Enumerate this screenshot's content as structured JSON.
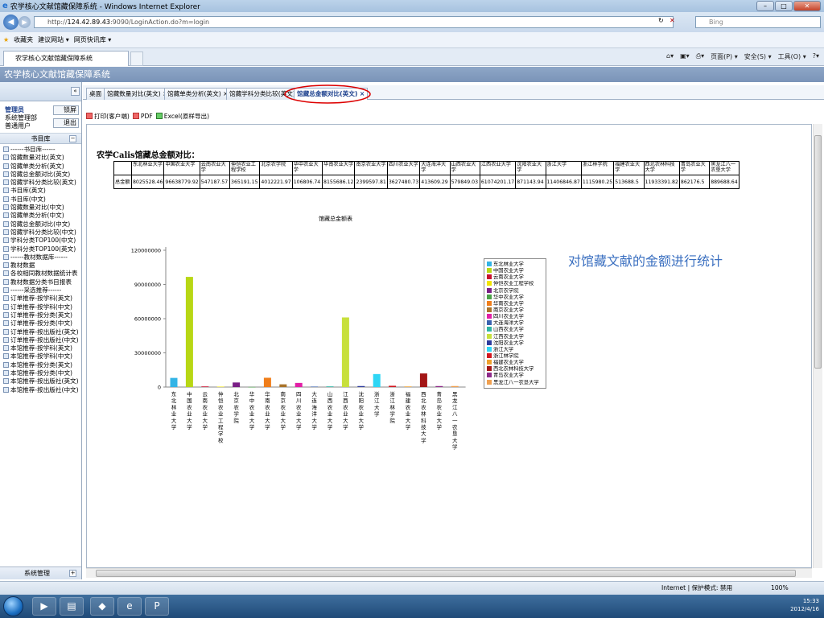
{
  "window": {
    "title": "农学核心文献馆藏保障系统 - Windows Internet Explorer",
    "min": "–",
    "max": "□",
    "close": "✕"
  },
  "address": {
    "prefix": "http://",
    "host": "124.42.89.43",
    "rest": ":9090/LoginAction.do?m=login",
    "search_placeholder": "Bing"
  },
  "favorites": {
    "label": "收藏夹",
    "items": [
      "建议网站 ▾",
      "网页快讯库 ▾"
    ]
  },
  "browser_tab": {
    "label": "农学核心文献馆藏保障系统"
  },
  "command_bar": [
    "页面(P) ▾",
    "安全(S) ▾",
    "工具(O) ▾"
  ],
  "app": {
    "header": "农学核心文献馆藏保障系统"
  },
  "sidebar": {
    "collapse": "«",
    "user": {
      "role": "管理员",
      "dept": "系统管理部",
      "type": "普通用户"
    },
    "lock_btn": "锁屏",
    "exit_btn": "退出",
    "library_header": "书目库",
    "items": [
      "------书目库------",
      "馆藏数量对比(英文)",
      "馆藏单类分析(英文)",
      "馆藏总金额对比(英文)",
      "馆藏学科分类比较(英文)",
      "书目库(英文)",
      "书目库(中文)",
      "馆藏数量对比(中文)",
      "馆藏单类分析(中文)",
      "馆藏总金额对比(中文)",
      "馆藏学科分类比较(中文)",
      "学科分类TOP100(中文)",
      "学科分类TOP100(英文)",
      "------教材数据库------",
      "教材数据",
      "各校相同教材数据统计表",
      "教材数据分类书目报表",
      "------采选推荐------",
      "订单推荐-按学科(英文)",
      "订单推荐-按学科(中文)",
      "订单推荐-按分类(英文)",
      "订单推荐-按分类(中文)",
      "订单推荐-按出版社(英文)",
      "订单推荐-按出版社(中文)",
      "本馆推荐-按学科(英文)",
      "本馆推荐-按学科(中文)",
      "本馆推荐-按分类(英文)",
      "本馆推荐-按分类(中文)",
      "本馆推荐-按出版社(英文)",
      "本馆推荐-按出版社(中文)"
    ],
    "footer": "系统管理",
    "footer_btn": "+"
  },
  "content_tabs": [
    {
      "label": "桌面"
    },
    {
      "label": "馆藏数量对比(英文) ×"
    },
    {
      "label": "馆藏单类分析(英文) ×"
    },
    {
      "label": "馆藏学科分类比较(英文) ×"
    },
    {
      "label": "馆藏总金额对比(英文) ×"
    }
  ],
  "toolbar": {
    "print": "打印(客户端)",
    "pdf": "PDF",
    "excel": "Excel(原样导出)"
  },
  "report": {
    "title": "农学Calis馆藏总金额对比：",
    "row_label": "总金额",
    "chart_title": "馆藏总金额表",
    "annotation": "对馆藏文献的金额进行统计"
  },
  "chart_data": {
    "type": "bar",
    "title": "馆藏总金额表",
    "categories": [
      "东北林业大学",
      "中国农业大学",
      "云南农业大学",
      "仲恺农业工程学校",
      "北京农学院",
      "华中农业大学",
      "华南农业大学",
      "南京农业大学",
      "四川农业大学",
      "大连海洋大学",
      "山西农业大学",
      "江西农业大学",
      "沈阳农业大学",
      "浙江大学",
      "浙江林学院",
      "福建农业大学",
      "西北农林科技大学",
      "青岛农业大学",
      "黑龙江八一农垦大学"
    ],
    "table_headers": [
      "东北林业大学",
      "中国农业大学",
      "云南农业大学",
      "仲恺农业工程学校",
      "北京农学院",
      "华中农业大学",
      "华南农业大学",
      "南京农业大学",
      "四川农业大学",
      "大连海洋大学",
      "山西农业大学",
      "江西农业大学",
      "沈阳农业大学",
      "浙江大学",
      "浙江林学院",
      "福建农业大学",
      "西北农林科技大学",
      "青岛农业大学",
      "黑龙江八一农垦大学"
    ],
    "table_values": [
      "8025528.46",
      "96638779.92",
      "547187.57",
      "365191.15",
      "4012221.97",
      "106806.74",
      "8155686.12",
      "2399597.81",
      "3627480.73",
      "413609.29",
      "579849.03",
      "61074201.17",
      "871143.94",
      "11406846.87",
      "1115980.25",
      "513688.5",
      "11933391.82",
      "862176.5",
      "889688.64"
    ],
    "values": [
      8025528.46,
      96638779.92,
      547187.57,
      365191.15,
      4012221.97,
      106806.74,
      8155686.12,
      2399597.81,
      3627480.73,
      413609.29,
      579849.03,
      61074201.17,
      871143.94,
      11406846.87,
      1115980.25,
      513688.5,
      11933391.82,
      862176.5,
      889688.64
    ],
    "colors": [
      "#33b4e6",
      "#b8d714",
      "#c8102e",
      "#f2e400",
      "#7a1f86",
      "#4aa146",
      "#f07e1b",
      "#a9732a",
      "#e21ea6",
      "#3a62b0",
      "#2fb4a4",
      "#c8e03c",
      "#2d3c9e",
      "#2fd6f5",
      "#d2171f",
      "#efa12d",
      "#a31616",
      "#8e2a8a",
      "#f0a050"
    ],
    "yticks": [
      "0",
      "30000000",
      "60000000",
      "90000000",
      "120000000"
    ],
    "ylim": [
      0,
      120000000
    ]
  },
  "status": {
    "zone": "Internet | 保护模式: 禁用",
    "zoom": "100%"
  },
  "taskbar": {
    "time": "15:33",
    "date": "2012/4/16"
  }
}
